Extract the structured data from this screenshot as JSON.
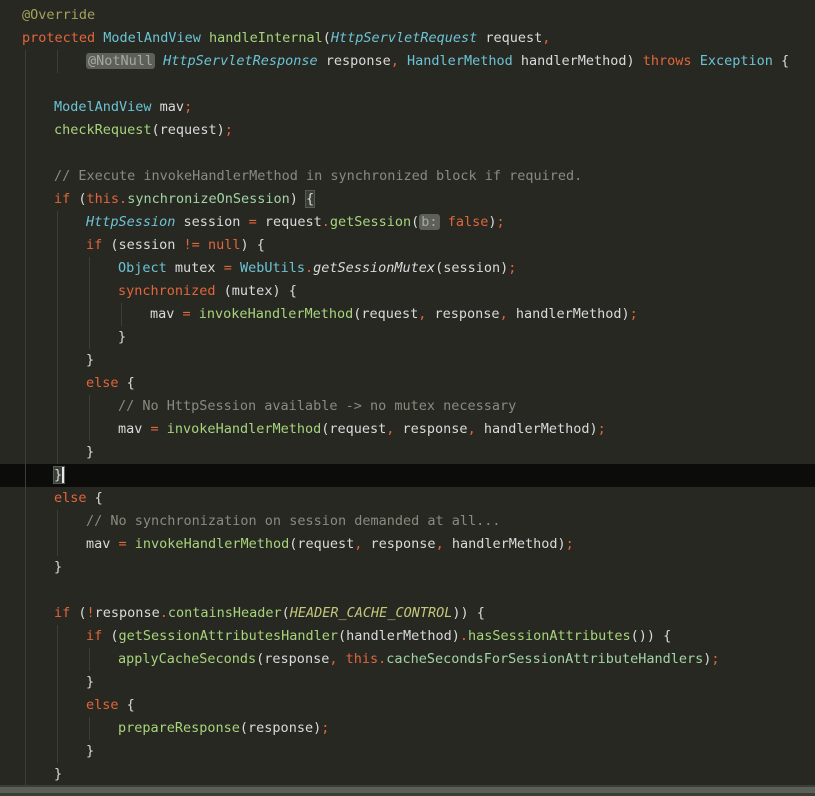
{
  "editor": {
    "lines": [
      {
        "indent": 0,
        "tokens": [
          {
            "t": "@Override",
            "c": "ann"
          }
        ]
      },
      {
        "indent": 0,
        "tokens": [
          {
            "t": "protected",
            "c": "kw"
          },
          {
            "t": " "
          },
          {
            "t": "ModelAndView",
            "c": "type"
          },
          {
            "t": " "
          },
          {
            "t": "handleInternal",
            "c": "fn"
          },
          {
            "t": "("
          },
          {
            "t": "HttpServletRequest",
            "c": "type-i"
          },
          {
            "t": " request"
          },
          {
            "t": ",",
            "c": "punc"
          }
        ]
      },
      {
        "indent": 2,
        "tokens": [
          {
            "t": "@NotNull",
            "c": "hint"
          },
          {
            "t": " "
          },
          {
            "t": "HttpServletResponse",
            "c": "type-i"
          },
          {
            "t": " response"
          },
          {
            "t": ",",
            "c": "punc"
          },
          {
            "t": " "
          },
          {
            "t": "HandlerMethod",
            "c": "type"
          },
          {
            "t": " handlerMethod) "
          },
          {
            "t": "throws",
            "c": "kw"
          },
          {
            "t": " "
          },
          {
            "t": "Exception",
            "c": "type"
          },
          {
            "t": " {"
          }
        ]
      },
      {
        "indent": 1,
        "tokens": []
      },
      {
        "indent": 1,
        "tokens": [
          {
            "t": "ModelAndView",
            "c": "type"
          },
          {
            "t": " mav"
          },
          {
            "t": ";",
            "c": "punc"
          }
        ]
      },
      {
        "indent": 1,
        "tokens": [
          {
            "t": "checkRequest",
            "c": "fn"
          },
          {
            "t": "(request)"
          },
          {
            "t": ";",
            "c": "punc"
          }
        ]
      },
      {
        "indent": 1,
        "tokens": []
      },
      {
        "indent": 1,
        "tokens": [
          {
            "t": "// Execute invokeHandlerMethod in synchronized block if required.",
            "c": "cm"
          }
        ]
      },
      {
        "indent": 1,
        "tokens": [
          {
            "t": "if",
            "c": "kw"
          },
          {
            "t": " ("
          },
          {
            "t": "this",
            "c": "kw"
          },
          {
            "t": ".",
            "c": "punc"
          },
          {
            "t": "synchronizeOnSession",
            "c": "field"
          },
          {
            "t": ") "
          },
          {
            "t": "{",
            "c": "bracehl"
          }
        ]
      },
      {
        "indent": 2,
        "tokens": [
          {
            "t": "HttpSession",
            "c": "type-i"
          },
          {
            "t": " session "
          },
          {
            "t": "=",
            "c": "op"
          },
          {
            "t": " request"
          },
          {
            "t": ".",
            "c": "punc"
          },
          {
            "t": "getSession",
            "c": "fn"
          },
          {
            "t": "("
          },
          {
            "t": "b:",
            "c": "hint"
          },
          {
            "t": " "
          },
          {
            "t": "false",
            "c": "kw"
          },
          {
            "t": ")"
          },
          {
            "t": ";",
            "c": "punc"
          }
        ]
      },
      {
        "indent": 2,
        "tokens": [
          {
            "t": "if",
            "c": "kw"
          },
          {
            "t": " (session "
          },
          {
            "t": "!=",
            "c": "op"
          },
          {
            "t": " "
          },
          {
            "t": "null",
            "c": "kw"
          },
          {
            "t": ") {"
          }
        ]
      },
      {
        "indent": 3,
        "tokens": [
          {
            "t": "Object",
            "c": "type"
          },
          {
            "t": " mutex "
          },
          {
            "t": "=",
            "c": "op"
          },
          {
            "t": " "
          },
          {
            "t": "WebUtils",
            "c": "type"
          },
          {
            "t": ".",
            "c": "punc"
          },
          {
            "t": "getSessionMutex",
            "c": "fn-i"
          },
          {
            "t": "(session)"
          },
          {
            "t": ";",
            "c": "punc"
          }
        ]
      },
      {
        "indent": 3,
        "tokens": [
          {
            "t": "synchronized",
            "c": "kw"
          },
          {
            "t": " (mutex) {"
          }
        ]
      },
      {
        "indent": 4,
        "tokens": [
          {
            "t": "mav "
          },
          {
            "t": "=",
            "c": "op"
          },
          {
            "t": " "
          },
          {
            "t": "invokeHandlerMethod",
            "c": "fn"
          },
          {
            "t": "(request"
          },
          {
            "t": ",",
            "c": "punc"
          },
          {
            "t": " response"
          },
          {
            "t": ",",
            "c": "punc"
          },
          {
            "t": " handlerMethod)"
          },
          {
            "t": ";",
            "c": "punc"
          }
        ]
      },
      {
        "indent": 3,
        "tokens": [
          {
            "t": "}"
          }
        ]
      },
      {
        "indent": 2,
        "tokens": [
          {
            "t": "}"
          }
        ]
      },
      {
        "indent": 2,
        "tokens": [
          {
            "t": "else",
            "c": "kw"
          },
          {
            "t": " {"
          }
        ]
      },
      {
        "indent": 3,
        "tokens": [
          {
            "t": "// No HttpSession available -> no mutex necessary",
            "c": "cm"
          }
        ]
      },
      {
        "indent": 3,
        "tokens": [
          {
            "t": "mav "
          },
          {
            "t": "=",
            "c": "op"
          },
          {
            "t": " "
          },
          {
            "t": "invokeHandlerMethod",
            "c": "fn"
          },
          {
            "t": "(request"
          },
          {
            "t": ",",
            "c": "punc"
          },
          {
            "t": " response"
          },
          {
            "t": ",",
            "c": "punc"
          },
          {
            "t": " handlerMethod)"
          },
          {
            "t": ";",
            "c": "punc"
          }
        ]
      },
      {
        "indent": 2,
        "tokens": [
          {
            "t": "}"
          }
        ]
      },
      {
        "indent": 1,
        "current": true,
        "tokens": [
          {
            "t": "}",
            "c": "bracehl caret"
          }
        ]
      },
      {
        "indent": 1,
        "tokens": [
          {
            "t": "else",
            "c": "kw"
          },
          {
            "t": " {"
          }
        ]
      },
      {
        "indent": 2,
        "tokens": [
          {
            "t": "// No synchronization on session demanded at all...",
            "c": "cm"
          }
        ]
      },
      {
        "indent": 2,
        "tokens": [
          {
            "t": "mav "
          },
          {
            "t": "=",
            "c": "op"
          },
          {
            "t": " "
          },
          {
            "t": "invokeHandlerMethod",
            "c": "fn"
          },
          {
            "t": "(request"
          },
          {
            "t": ",",
            "c": "punc"
          },
          {
            "t": " response"
          },
          {
            "t": ",",
            "c": "punc"
          },
          {
            "t": " handlerMethod)"
          },
          {
            "t": ";",
            "c": "punc"
          }
        ]
      },
      {
        "indent": 1,
        "tokens": [
          {
            "t": "}"
          }
        ]
      },
      {
        "indent": 1,
        "tokens": []
      },
      {
        "indent": 1,
        "tokens": [
          {
            "t": "if",
            "c": "kw"
          },
          {
            "t": " ("
          },
          {
            "t": "!",
            "c": "op"
          },
          {
            "t": "response"
          },
          {
            "t": ".",
            "c": "punc"
          },
          {
            "t": "containsHeader",
            "c": "fn"
          },
          {
            "t": "("
          },
          {
            "t": "HEADER_CACHE_CONTROL",
            "c": "const"
          },
          {
            "t": ")) {"
          }
        ]
      },
      {
        "indent": 2,
        "tokens": [
          {
            "t": "if",
            "c": "kw"
          },
          {
            "t": " ("
          },
          {
            "t": "getSessionAttributesHandler",
            "c": "fn"
          },
          {
            "t": "(handlerMethod)"
          },
          {
            "t": ".",
            "c": "punc"
          },
          {
            "t": "hasSessionAttributes",
            "c": "fn"
          },
          {
            "t": "()) {"
          }
        ]
      },
      {
        "indent": 3,
        "tokens": [
          {
            "t": "applyCacheSeconds",
            "c": "fn"
          },
          {
            "t": "(response"
          },
          {
            "t": ",",
            "c": "punc"
          },
          {
            "t": " "
          },
          {
            "t": "this",
            "c": "kw"
          },
          {
            "t": ".",
            "c": "punc"
          },
          {
            "t": "cacheSecondsForSessionAttributeHandlers",
            "c": "field"
          },
          {
            "t": ")"
          },
          {
            "t": ";",
            "c": "punc"
          }
        ]
      },
      {
        "indent": 2,
        "tokens": [
          {
            "t": "}"
          }
        ]
      },
      {
        "indent": 2,
        "tokens": [
          {
            "t": "else",
            "c": "kw"
          },
          {
            "t": " {"
          }
        ]
      },
      {
        "indent": 3,
        "tokens": [
          {
            "t": "prepareResponse",
            "c": "fn"
          },
          {
            "t": "(response)"
          },
          {
            "t": ";",
            "c": "punc"
          }
        ]
      },
      {
        "indent": 2,
        "tokens": [
          {
            "t": "}"
          }
        ]
      },
      {
        "indent": 1,
        "tokens": [
          {
            "t": "}"
          }
        ]
      }
    ]
  },
  "colors": {
    "background": "#272822",
    "keyword": "#e2653c",
    "type": "#6cc3d5",
    "method": "#a7d47c",
    "comment": "#8a8a80",
    "annotation": "#a2a15a"
  }
}
